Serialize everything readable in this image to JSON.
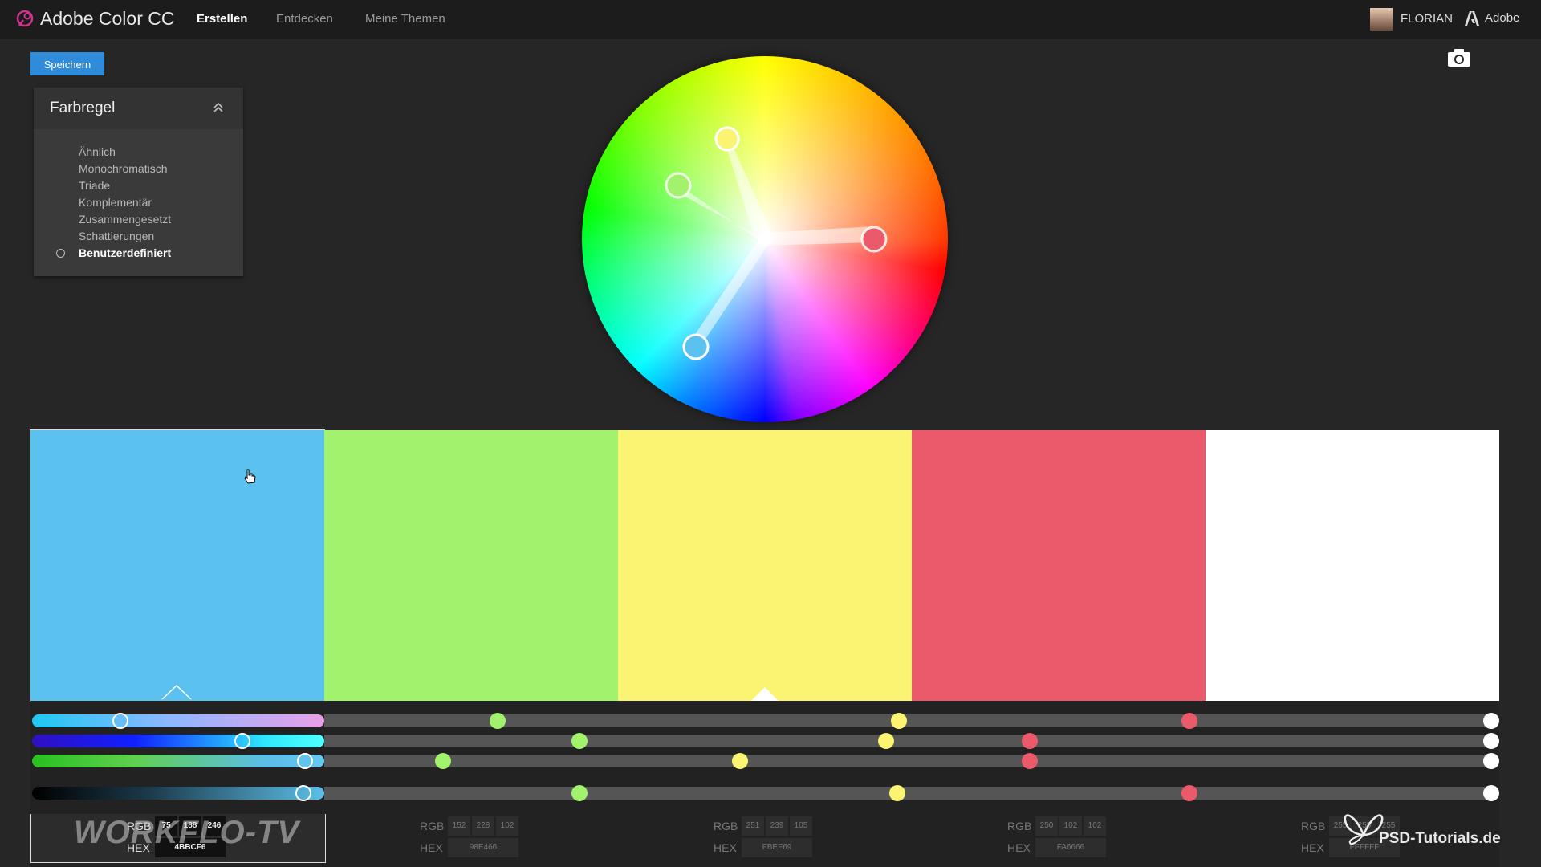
{
  "app": {
    "title": "Adobe Color CC"
  },
  "nav": {
    "items": [
      {
        "label": "Erstellen",
        "active": true
      },
      {
        "label": "Entdecken",
        "active": false
      },
      {
        "label": "Meine Themen",
        "active": false
      }
    ]
  },
  "user": {
    "name": "FLORIAN"
  },
  "adobe": {
    "label": "Adobe"
  },
  "toolbar": {
    "save_label": "Speichern"
  },
  "panel": {
    "title": "Farbregel",
    "rules": [
      "Ähnlich",
      "Monochromatisch",
      "Triade",
      "Komplementär",
      "Zusammengesetzt",
      "Schattierungen",
      "Benutzerdefiniert"
    ],
    "selected_rule": "Benutzerdefiniert"
  },
  "colors": {
    "swatches": [
      {
        "hex": "#5BC2F0",
        "hex_label": "4BBCF6",
        "rgb": [
          "75",
          "188",
          "246"
        ],
        "selected": true
      },
      {
        "hex": "#A3F26E",
        "hex_label": "98E466",
        "rgb": [
          "152",
          "228",
          "102"
        ],
        "selected": false
      },
      {
        "hex": "#FAF472",
        "hex_label": "FBEF69",
        "rgb": [
          "251",
          "239",
          "105"
        ],
        "selected": false
      },
      {
        "hex": "#EB5A6A",
        "hex_label": "FA6666",
        "rgb": [
          "250",
          "102",
          "102"
        ],
        "selected": false
      },
      {
        "hex": "#FFFFFF",
        "hex_label": "FFFFFF",
        "rgb": [
          "255",
          "255",
          "255"
        ],
        "selected": false
      }
    ],
    "rgb_label": "RGB",
    "hex_label": "HEX"
  },
  "watermarks": {
    "left": "WORKFLO-TV",
    "right": "PSD-Tutorials.de"
  }
}
